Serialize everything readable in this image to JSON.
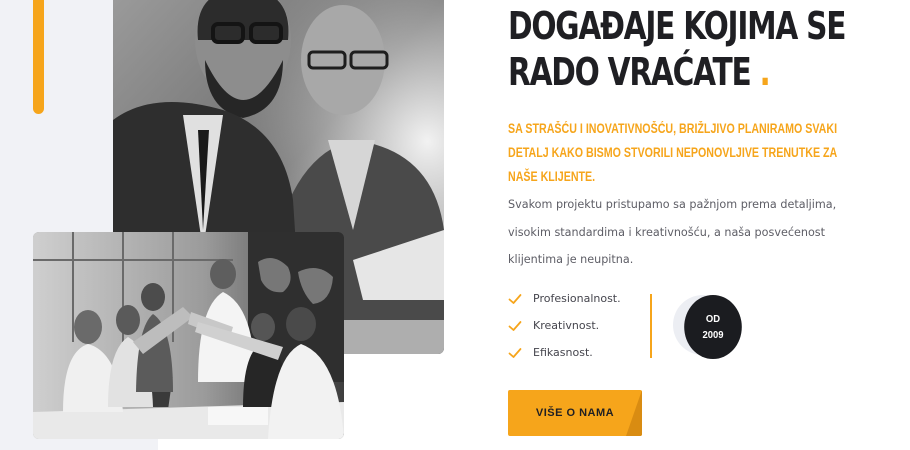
{
  "hero": {
    "heading_line1": "DOGAĐAJE KOJIMA SE",
    "heading_line2": "RADO VRAĆATE",
    "heading_dot": ".",
    "subheading": "SA STRAŠĆU I INOVATIVNOŠĆU, BRIŽLJIVO PLANIRAMO SVAKI DETALJ KAKO BISMO STVORILI NEPONOVLJIVE TRENUTKE ZA NAŠE KLIJENTE.",
    "description": "Svakom projektu pristupamo sa pažnjom prema detaljima, visokim standardima i kreativnošću, a naša posvećenost klijentima je neupitna."
  },
  "features": [
    {
      "label": "Profesionalnost.",
      "icon": "check-icon"
    },
    {
      "label": "Kreativnost.",
      "icon": "check-icon"
    },
    {
      "label": "Efikasnost.",
      "icon": "check-icon"
    }
  ],
  "badge": {
    "line1": "OD",
    "line2": "2009"
  },
  "cta": {
    "label": "VIŠE O NAMA"
  },
  "colors": {
    "accent": "#f6a51b",
    "dark": "#1b1c20",
    "panel": "#f1f2f6"
  }
}
